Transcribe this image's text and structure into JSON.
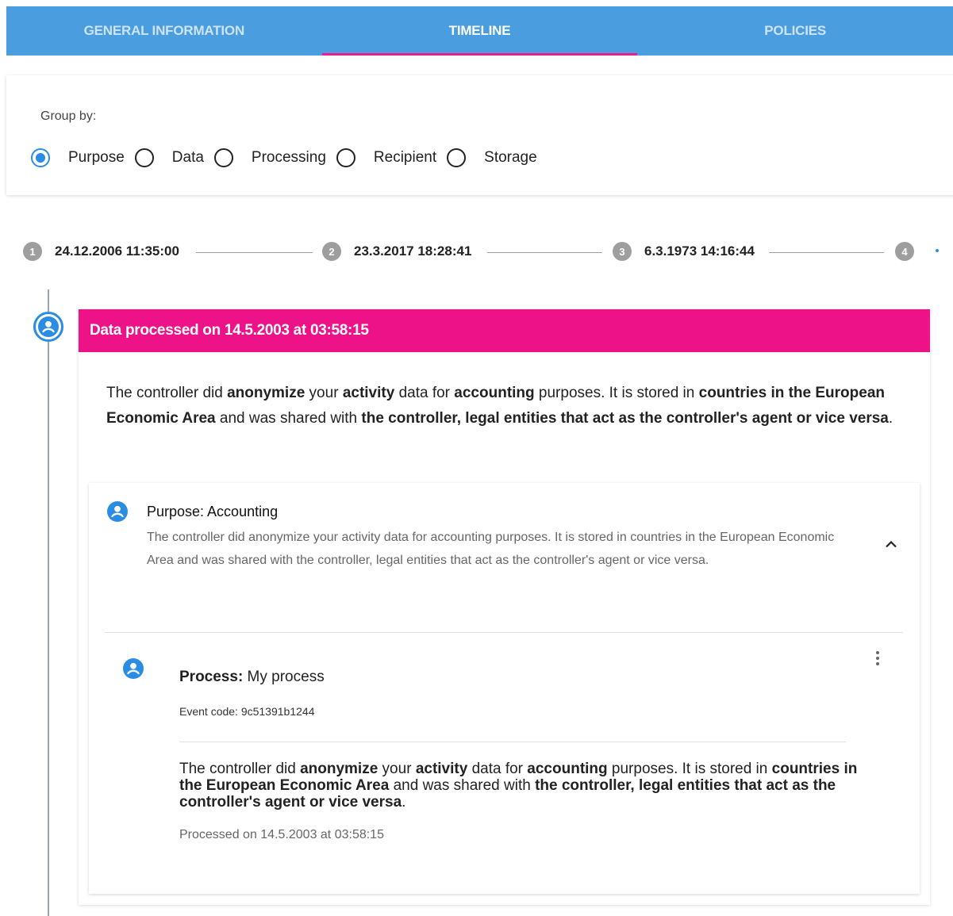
{
  "tabs": [
    {
      "label": "GENERAL INFORMATION",
      "active": false
    },
    {
      "label": "TIMELINE",
      "active": true
    },
    {
      "label": "POLICIES",
      "active": false
    }
  ],
  "group_by": {
    "label": "Group by:",
    "selected": "Purpose",
    "options": [
      "Purpose",
      "Data",
      "Processing",
      "Recipient",
      "Storage"
    ]
  },
  "stepper": {
    "steps": [
      {
        "num": "1",
        "date": "24.12.2006 11:35:00"
      },
      {
        "num": "2",
        "date": "23.3.2017 18:28:41"
      },
      {
        "num": "3",
        "date": "6.3.1973 14:16:44"
      },
      {
        "num": "4",
        "date": ""
      }
    ]
  },
  "event": {
    "header": "Data processed on 14.5.2003 at 03:58:15",
    "summary": {
      "p1": "The controller did ",
      "action": "anonymize",
      "p2": " your ",
      "data": "activity",
      "p3": " data for ",
      "purpose": "accounting",
      "p4": " purposes. It is stored in ",
      "storage": "countries in the European Economic Area",
      "p5": " and was shared with ",
      "recipient": "the controller, legal entities that act as the controller's agent or vice versa",
      "p6": "."
    },
    "purpose_card": {
      "title": "Purpose: Accounting",
      "description": "The controller did anonymize your activity data for accounting purposes. It is stored in countries in the European Economic Area and was shared with the controller, legal entities that act as the controller's agent or vice versa.",
      "process": {
        "label": "Process:",
        "name": " My process",
        "event_code": "Event code: 9c51391b1244",
        "summary": {
          "p1": "The controller did ",
          "action": "anonymize",
          "p2": " your ",
          "data": "activity",
          "p3": " data for ",
          "purpose": "accounting",
          "p4": " purposes. It is stored in ",
          "storage": "countries in the European Economic Area",
          "p5": " and was shared with ",
          "recipient": "the controller, legal entities that act as the controller's agent or vice versa",
          "p6": "."
        },
        "processed_on": "Processed on 14.5.2003 at 03:58:15"
      }
    }
  },
  "colors": {
    "tab_bar": "#4a9ddf",
    "accent_pink": "#ee1289",
    "accent_blue": "#2b8ce3"
  },
  "icons": {
    "timeline_marker": "account-circle-icon",
    "purpose": "account-circle-icon",
    "process": "account-circle-icon",
    "collapse": "chevron-up-icon",
    "more": "more-vert-icon"
  }
}
